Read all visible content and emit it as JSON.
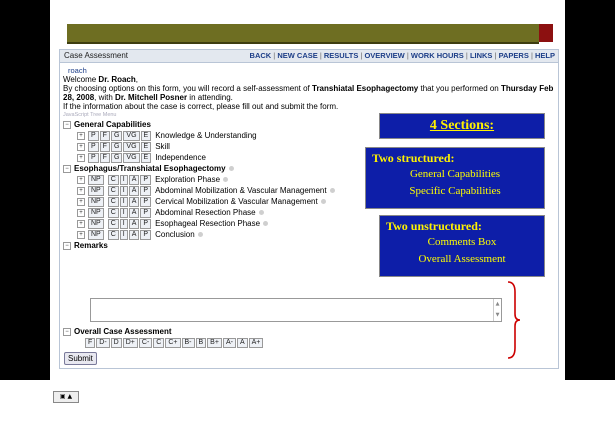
{
  "header": {
    "title": "Case Assessment",
    "menu": [
      "BACK",
      "NEW CASE",
      "RESULTS",
      "OVERVIEW",
      "WORK HOURS",
      "LINKS",
      "PAPERS",
      "HELP"
    ]
  },
  "user": "roach",
  "welcome": {
    "prefix": "Welcome ",
    "name": "Dr. Roach",
    "suffix": ","
  },
  "intro": {
    "p1": "By choosing options on this form, you will record a self-assessment of ",
    "procedure": "Transhiatal Esophagectomy",
    "p2": " that you performed on ",
    "date": "Thursday Feb 28, 2008",
    "p3": ", with ",
    "attending": "Dr. Mitchell Posner",
    "p4": " in attending.",
    "line2": "If the information about the case is correct, please fill out and submit the form."
  },
  "js_menu_label": "JavaScript Tree Menu",
  "general": {
    "title": "General Capabilities",
    "grades": [
      "P",
      "F",
      "G",
      "VG",
      "E"
    ],
    "items": [
      "Knowledge & Understanding",
      "Skill",
      "Independence"
    ]
  },
  "specific": {
    "title": "Esophagus/Transhiatal Esophagectomy",
    "np": "NP",
    "grades": [
      "C",
      "I",
      "A",
      "P"
    ],
    "items": [
      "Exploration Phase",
      "Abdominal Mobilization & Vascular Management",
      "Cervical Mobilization & Vascular Management",
      "Abdominal Resection Phase",
      "Esophageal Resection Phase",
      "Conclusion"
    ]
  },
  "remarks": {
    "title": "Remarks"
  },
  "overall": {
    "title": "Overall Case Assessment",
    "grades": [
      "F",
      "D-",
      "D",
      "D+",
      "C-",
      "C",
      "C+",
      "B-",
      "B",
      "B+",
      "A-",
      "A",
      "A+"
    ]
  },
  "submit_label": "Submit",
  "callouts": {
    "sections": "4 Sections:",
    "structured_title": "Two structured:",
    "structured_items": [
      "General Capabilities",
      "Specific Capabilities"
    ],
    "unstructured_title": "Two unstructured:",
    "unstructured_items": [
      "Comments Box",
      "Overall Assessment"
    ]
  },
  "colors": {
    "callout_bg": "#0d1ea8",
    "callout_text": "#fff200",
    "brace": "#cc0000",
    "header_band": "#6e6e22",
    "link": "#1d3e88"
  }
}
